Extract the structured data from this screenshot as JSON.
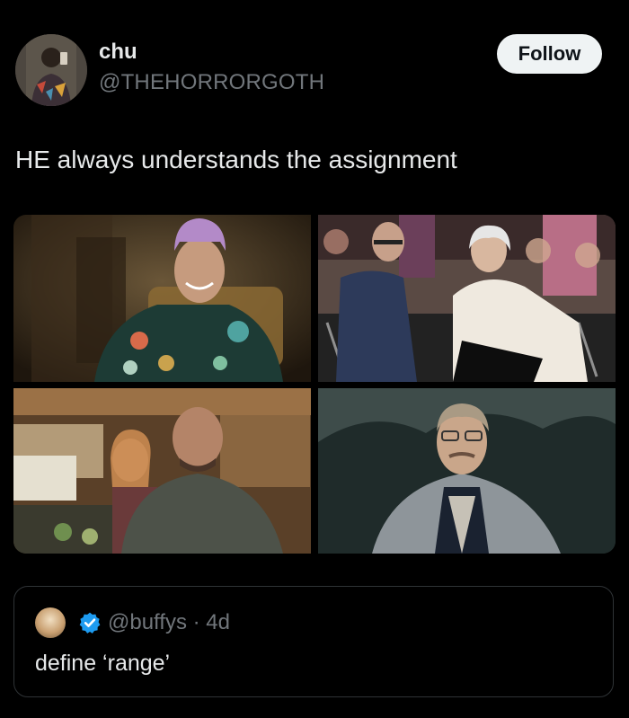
{
  "post": {
    "author_name": "chu",
    "author_handle": "@THEHORRORGOTH",
    "follow_label": "Follow",
    "text": "HE always understands the assignment"
  },
  "media": {
    "photos": [
      {
        "description": "man with purple hair in floral suit smiling"
      },
      {
        "description": "two people seated on patterned sofa at fashion show"
      },
      {
        "description": "bald man in grey shirt with woman in kitchen"
      },
      {
        "description": "man with glasses and mustache in grey coat outdoors"
      }
    ]
  },
  "quote": {
    "handle_time": "@buffys · 4d",
    "text": "define ‘range’"
  },
  "icons": {
    "verified": "verified-badge-icon"
  },
  "colors": {
    "background": "#000000",
    "text": "#e7e9ea",
    "muted": "#71767b",
    "follow_bg": "#eff3f4",
    "verified": "#1d9bf0",
    "border": "#2f3336"
  }
}
